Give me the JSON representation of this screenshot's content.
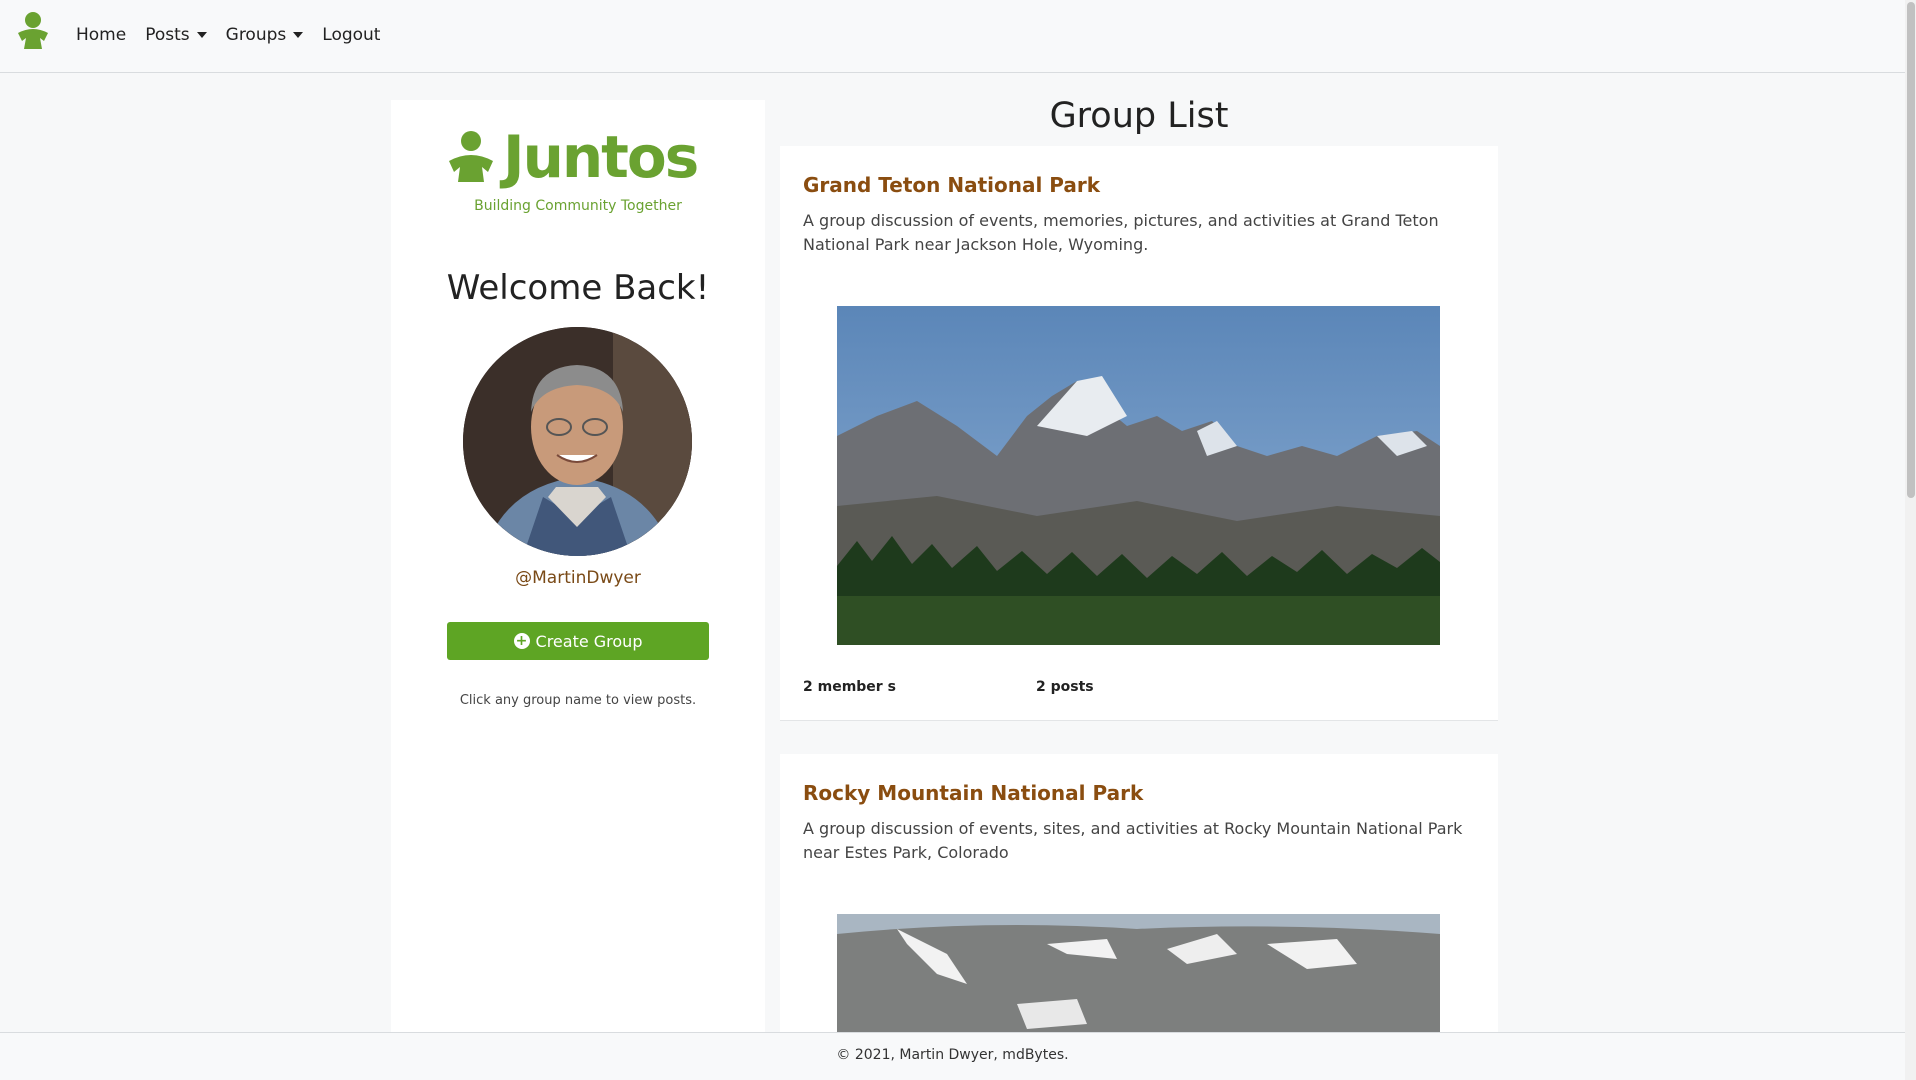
{
  "nav": {
    "items": [
      {
        "label": "Home",
        "dropdown": false
      },
      {
        "label": "Posts",
        "dropdown": true
      },
      {
        "label": "Groups",
        "dropdown": true
      },
      {
        "label": "Logout",
        "dropdown": false
      }
    ]
  },
  "sidebar": {
    "brand": "Juntos",
    "tagline": "Building Community Together",
    "welcome": "Welcome Back!",
    "username": "@MartinDwyer",
    "create_button": "Create Group",
    "hint": "Click any group name to view posts."
  },
  "main": {
    "title": "Group List",
    "groups": [
      {
        "name": "Grand Teton National Park",
        "description": "A group discussion of events, memories, pictures, and activities at Grand Teton National Park near Jackson Hole, Wyoming.",
        "members": "2  member s",
        "posts": "2  posts"
      },
      {
        "name": "Rocky Mountain National Park",
        "description": "A group discussion of events, sites, and activities at Rocky Mountain National Park near Estes Park, Colorado"
      }
    ]
  },
  "footer": {
    "text": "© 2021, Martin Dwyer, mdBytes."
  },
  "colors": {
    "brand_green": "#6aa231",
    "button_green": "#5ea524",
    "title_brown": "#8a4d10",
    "username_brown": "#7a4a17"
  }
}
